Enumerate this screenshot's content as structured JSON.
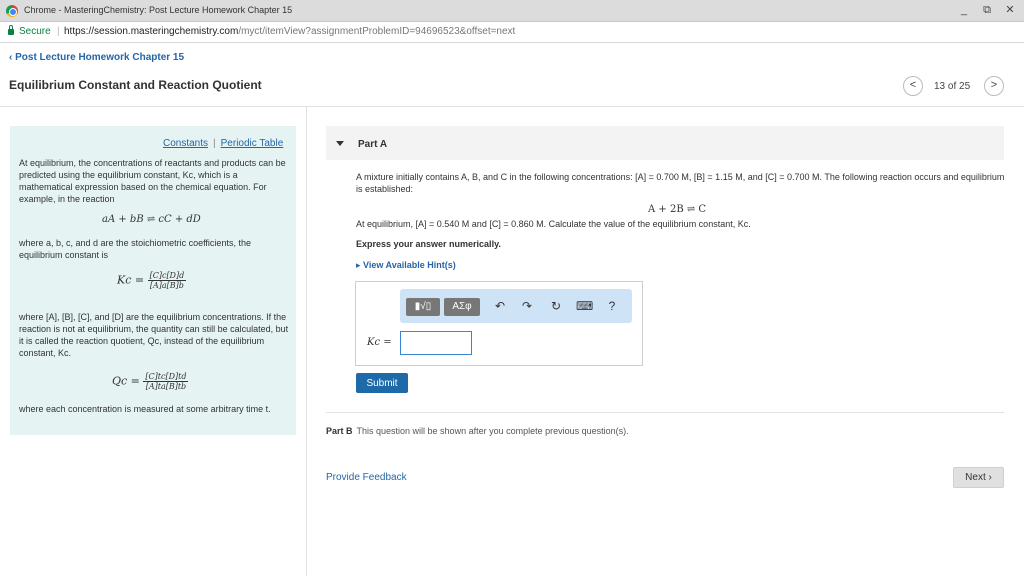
{
  "window": {
    "title": "Chrome - MasteringChemistry: Post Lecture Homework Chapter 15",
    "minimize": "_",
    "restore": "⧉",
    "close": "✕"
  },
  "address": {
    "secure_label": "Secure",
    "separator": "|",
    "url_host": "https://session.masteringchemistry.com",
    "url_path": "/myct/itemView?assignmentProblemID=94696523&offset=next"
  },
  "header": {
    "back_label": "Post Lecture Homework Chapter 15",
    "title": "Equilibrium Constant and Reaction Quotient",
    "pager_text": "13 of 25",
    "prev_symbol": "<",
    "next_symbol": ">"
  },
  "info": {
    "links": [
      "Constants",
      "Periodic Table"
    ],
    "link_separator": "|",
    "intro": "At equilibrium, the concentrations of reactants and products can be predicted using the equilibrium constant, Kc, which is a mathematical expression based on the chemical equation. For example, in the reaction",
    "general_reaction": "aA + bB ⇌ cC + dD",
    "coeff_text": "where a, b, c, and d are the stoichiometric coefficients, the equilibrium constant is",
    "kc_lhs": "Kc =",
    "kc_num": "[C]c[D]d",
    "kc_den": "[A]a[B]b",
    "q_text": "where [A], [B], [C], and [D] are the equilibrium concentrations. If the reaction is not at equilibrium, the quantity can still be calculated, but it is called the reaction quotient, Qc, instead of the equilibrium constant, Kc.",
    "qc_lhs": "Qc =",
    "qc_num": "[C]tc[D]td",
    "qc_den": "[A]ta[B]tb",
    "footer": "where each concentration is measured at some arbitrary time t."
  },
  "partA": {
    "label": "Part A",
    "q1": "A mixture initially contains A, B, and C in the following concentrations: [A] = 0.700 M, [B] = 1.15 M, and [C] = 0.700 M. The following reaction occurs and equilibrium is established:",
    "reaction": "A + 2B ⇌ C",
    "q2": "At equilibrium, [A] = 0.540 M and [C] = 0.860 M. Calculate the value of the equilibrium constant, Kc.",
    "express": "Express your answer numerically.",
    "hints": "View Available Hint(s)",
    "toolbar": {
      "templates": "▮√▯",
      "symbols": "ΑΣφ",
      "undo": "↶",
      "redo": "↷",
      "reset": "↻",
      "keyboard": "⌨",
      "help": "?"
    },
    "answer_label": "Kc =",
    "answer_value": "",
    "submit": "Submit"
  },
  "partB": {
    "label": "Part B",
    "text": "This question will be shown after you complete previous question(s)."
  },
  "footer": {
    "feedback": "Provide Feedback",
    "next": "Next ›"
  }
}
